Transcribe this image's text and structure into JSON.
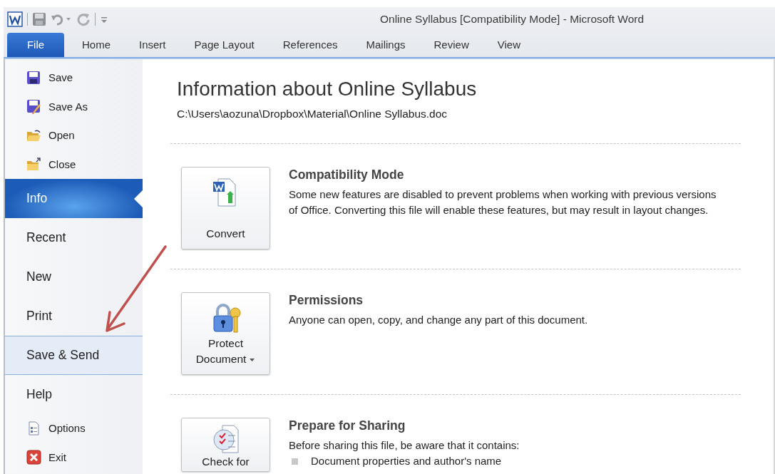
{
  "window": {
    "title": "Online Syllabus [Compatibility Mode]  -  Microsoft Word"
  },
  "tabs": [
    {
      "label": "File",
      "selected": true
    },
    {
      "label": "Home",
      "selected": false
    },
    {
      "label": "Insert",
      "selected": false
    },
    {
      "label": "Page Layout",
      "selected": false
    },
    {
      "label": "References",
      "selected": false
    },
    {
      "label": "Mailings",
      "selected": false
    },
    {
      "label": "Review",
      "selected": false
    },
    {
      "label": "View",
      "selected": false
    }
  ],
  "sidebar": {
    "items": [
      {
        "label": "Save",
        "kind": "command",
        "selected": false,
        "highlighted": false
      },
      {
        "label": "Save As",
        "kind": "command",
        "selected": false,
        "highlighted": false
      },
      {
        "label": "Open",
        "kind": "command",
        "selected": false,
        "highlighted": false
      },
      {
        "label": "Close",
        "kind": "command",
        "selected": false,
        "highlighted": false
      },
      {
        "label": "Info",
        "kind": "page",
        "selected": true,
        "highlighted": false
      },
      {
        "label": "Recent",
        "kind": "page",
        "selected": false,
        "highlighted": false
      },
      {
        "label": "New",
        "kind": "page",
        "selected": false,
        "highlighted": false
      },
      {
        "label": "Print",
        "kind": "page",
        "selected": false,
        "highlighted": false
      },
      {
        "label": "Save & Send",
        "kind": "page",
        "selected": false,
        "highlighted": true
      },
      {
        "label": "Help",
        "kind": "page",
        "selected": false,
        "highlighted": false
      },
      {
        "label": "Options",
        "kind": "command",
        "selected": false,
        "highlighted": false
      },
      {
        "label": "Exit",
        "kind": "command",
        "selected": false,
        "highlighted": false
      }
    ]
  },
  "info": {
    "title": "Information about Online Syllabus",
    "path": "C:\\Users\\aozuna\\Dropbox\\Material\\Online Syllabus.doc",
    "sections": [
      {
        "heading": "Compatibility Mode",
        "text": "Some new features are disabled to prevent problems when working with previous versions of Office. Converting this file will enable these features, but may result in layout changes.",
        "button": {
          "label": "Convert",
          "dropdown": false
        }
      },
      {
        "heading": "Permissions",
        "text": "Anyone can open, copy, and change any part of this document.",
        "button": {
          "label": "Protect Document",
          "dropdown": true
        }
      },
      {
        "heading": "Prepare for Sharing",
        "text": "Before sharing this file, be aware that it contains:",
        "bullets": [
          "Document properties and author's name"
        ],
        "button": {
          "label": "Check for",
          "dropdown": false
        }
      }
    ]
  }
}
